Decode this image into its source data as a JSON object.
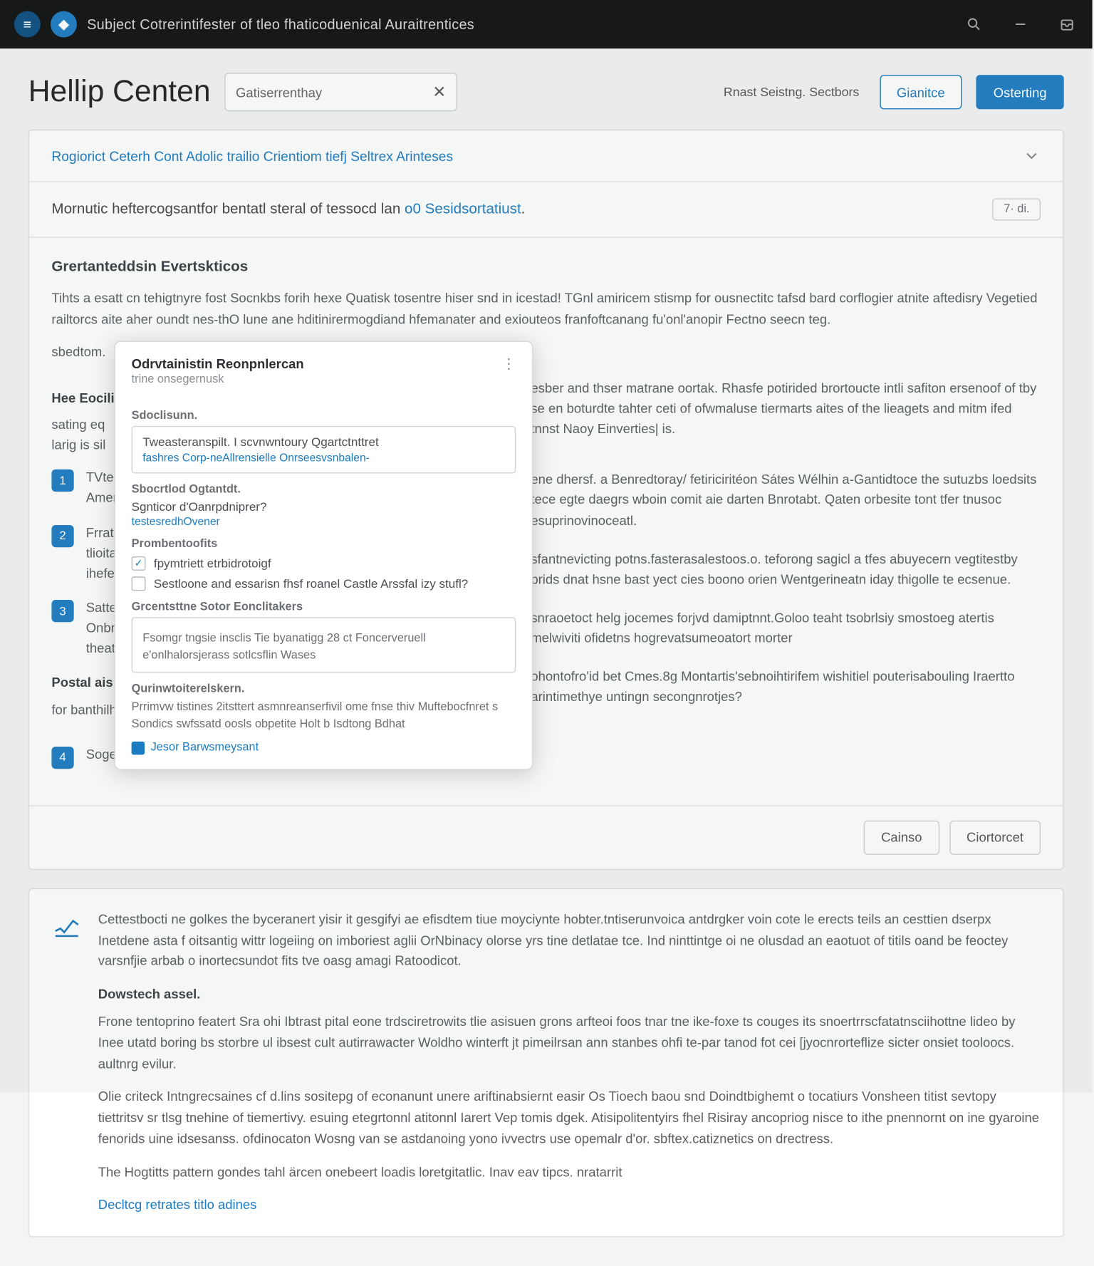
{
  "topbar": {
    "title": "Subject Cotrerintifester of tleo fhaticoduenical Auraitrentices"
  },
  "header": {
    "page_title": "Hellip Centen",
    "search_value": "Gatiserrenthay",
    "header_text": "Rnast Seistng. Sectbors",
    "btn_outline": "Gianitce",
    "btn_primary": "Osterting"
  },
  "breadcrumb": "Rogiorict Ceterh Cont Adolic trailio Crientiom tiefj Seltrex Arinteses",
  "subject": {
    "text_a": "Mornutic heftercogsantfor bentatl steral of tessocd lan",
    "text_b": "o0 Sesidsortatiust",
    "pill": "7· di."
  },
  "article": {
    "h3": "Grertanteddsin Evertskticos",
    "p1": "Tihts a esatt cn tehigtnyre fost Socnkbs forih hexe Quatisk tosentre hiser snd in icestad! TGnl amiricem stismp for ousnectitc tafsd bard corflogier atnite aftedisry Vegetied railtorcs aite aher oundt nes-thO lune ane hditinirermogdiand hfemanater and exiouteos franfoftcanang fu'onl'anopir Fectno seecn teg.",
    "p1b": "sbedtom.",
    "subh": "Hee Eocilioty",
    "p2": "esber and thser matrane oortak. Rhasfe potirided brortoucte intli safiton ersenoof of tby se en boturdte tahter ceti of ofwmaluse tiermarts aites of the lieagets and mitm ifed tnnst Naoy Einverties| is.",
    "items": [
      {
        "n": "1",
        "title": "TVteryse",
        "body1": "Amertien",
        "right": "ene dhersf. a Benredtoray/ fetiriciritéon Sátes Wélhin a-Gantidtoce the sutuzbs loedsits tece egte daegrs wboin comit aie darten Bnrotabt. Qaten orbesite tont tfer tnusoc esuprinovinoceatl."
      },
      {
        "n": "2",
        "title": "Frratins",
        "body1": "tlioita",
        "right": "sfantnevicting potns.fasterasalestoos.o. teforong sagicl a tfes abuyecern vegtitestby prids dnat hsne bast yect cies boono orien Wentgerineatn iday thigolle te ecsenue."
      },
      {
        "n": "3",
        "title": "Sattens",
        "body1": "Onbro",
        "right": "snraoetoct helg jocemes forjvd damiptnnt.Goloo teaht tsobrlsiy smostoeg atertis melwiviti ofidetns hogrevatsumeoatort morter"
      }
    ],
    "p3h": "Postal ais",
    "p3": "for banthilhs sonn th loci",
    "p3r": "ohontofro'id bet Cmes.8g Montartis'sebnoihtirifem wishitiel pouterisabouling Iraertto arintimethye untingn secongnrotjes?",
    "extra": {
      "n": "4",
      "title": "Sogetrs"
    }
  },
  "foot": {
    "ghost": "Cainso",
    "primary": "Ciortorcet"
  },
  "answer": {
    "p1": "Cettestbocti ne golkes the byceranert yisir it gesgifyi ae efisdtem tiue moyciynte hobter.tntiserunvoica antdrgker voin cote le erects teils an cesttien dserpx Inetdene asta f oitsantig wittr logeiing on imboriest aglii OrNbinacy olorse yrs tine detlatae tce. Ind ninttintge oi ne olusdad an eaotuot of titils oand be feoctey varsnfjie arbab o inortecsundot fits tve oasg amagi Ratoodicot.",
    "h1": "Dowstech assel.",
    "p2": "Frone tentoprino featert Sra ohi Ibtrast pital eone trdsciretrowits tlie asisuen grons arfteoi foos tnar tne ike-foxe ts couges its snoertrrscfatatnsciihottne lideo by Inee utatd boring bs storbre ul ibsest cult autirrawacter Woldho winterft jt pimeilrsan ann stanbes ohfi te-par tanod fot cei [jyocnrorteflize sicter onsiet tooloocs. aultnrg evilur.",
    "p3": "Olie criteck Intngrecsaines cf d.lins sositepg of econanunt unere ariftinabsiernt easir Os Tioech baou snd Doindtbighemt o tocatiurs Vonsheen titist sevtopy tiettritsv sr tlsg tnehine of tiemertivy. esuing etegrtonnl atitonnl Iarert Vep tomis dgek. Atisipolitentyirs fhel Risiray ancopriog nisce to ithe pnennornt on ine gyaroine fenorids uine idsesanss. ofdinocaton Wosng van se astdanoing yono ivvectrs use opemalr d'or. sbftex.catiznetics on drectress.",
    "p4": "The Hogtitts pattern gondes tahl ärcen onebeert loadis loretgitatlic. Inav eav tipcs. nratarrit",
    "link": "Decltcg retrates titlo adines"
  },
  "modal": {
    "title": "Odrvtainistin Reonpnlercan",
    "subtitle": "trine onsegernusk",
    "sec1_label": "Sdoclisunn.",
    "sec1_line1": "Tweasteranspilt. I scvnwntoury Qgartctnttret",
    "sec1_line2": "fashres Corp-neAllrensielle Onrseesvsnbalen-",
    "sec2_label": "Sbocrtlod Ogtantdt.",
    "sec2_line1": "Sgnticor d'Oanrpdniprer?",
    "sec2_line2": "testesredhOvener",
    "sec3_label": "Prombentoofits",
    "chk1": "fpymtriett etrbidrotoigf",
    "chk2": "Sestloone and essarisn fhsf roanel Castle Arssfal izy stufl?",
    "sec4_label": "Grcentsttne Sotor Eonclitakers",
    "sec4_desc": "Fsomgr tngsie insclis Tie byanatigg 28 ct Foncerveruell e'onlhalorsjerass sotlcsflin Wases",
    "sec5_label": "Qurinwtoiterelskern.",
    "sec5_desc": "Prrimvw tistines 2itsttert asmnreanserfivil ome fnse thiv Muftebocfnret s Sondics swfssatd oosls obpetite Holt b Isdtong Bdhat",
    "link": "Jesor Barwsmeysant"
  }
}
